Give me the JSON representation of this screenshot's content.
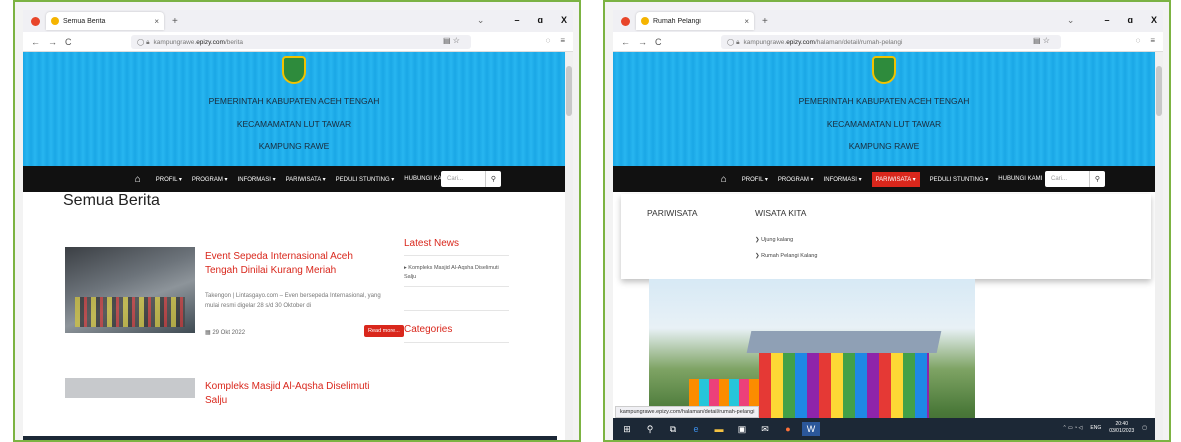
{
  "left": {
    "tab_title": "Semua Berita",
    "tab_close": "×",
    "new_tab": "+",
    "url_prefix": "kampungrawe.",
    "url_host": "epizy.com",
    "url_path": "/berita",
    "banner": {
      "line1": "PEMERINTAH KABUPATEN ACEH TENGAH",
      "line2": "KECAMAMATAN LUT TAWAR",
      "line3": "KAMPUNG RAWE"
    },
    "menu": [
      "PROFIL ▾",
      "PROGRAM ▾",
      "INFORMASI ▾",
      "PARIWISATA ▾",
      "PEDULI STUNTING ▾",
      "HUBUNGI KAMI"
    ],
    "search_placeholder": "Cari...",
    "page_title": "Semua Berita",
    "posts": [
      {
        "title": "Event Sepeda Internasional Aceh Tengah Dinilai Kurang Meriah",
        "excerpt": "Takengon | Lintasgayo.com – Even bersepeda Internasional, yang mulai resmi digelar 28 s/d 30 Oktober di",
        "date": "29 Okt 2022",
        "read_more": "Read more..."
      },
      {
        "title": "Kompleks Masjid Al-Aqsha Diselimuti Salju"
      }
    ],
    "sidebar": {
      "latest_heading": "Latest News",
      "latest_item": "▸ Kompleks Masjid Al-Aqsha Diselimuti Salju",
      "categories_heading": "Categories"
    }
  },
  "right": {
    "tab_title": "Rumah Pelangi",
    "tab_close": "×",
    "new_tab": "+",
    "url_prefix": "kampungrawe.",
    "url_host": "epizy.com",
    "url_path": "/halaman/detail/rumah-pelangi",
    "banner": {
      "line1": "PEMERINTAH KABUPATEN ACEH TENGAH",
      "line2": "KECAMAMATAN LUT TAWAR",
      "line3": "KAMPUNG RAWE"
    },
    "menu": [
      "PROFIL ▾",
      "PROGRAM ▾",
      "INFORMASI ▾",
      "PARIWISATA ▾",
      "PEDULI STUNTING ▾",
      "HUBUNGI KAMI"
    ],
    "search_placeholder": "Cari...",
    "mega": {
      "col1": "PARIWISATA",
      "col2": "WISATA KITA",
      "items": [
        "❯ Ujung kalang",
        "❯ Rumah Pelangi Kalang"
      ]
    },
    "status_link": "kampungrawe.epizy.com/halaman/detail/rumah-pelangi",
    "tray": {
      "lang": "ENG",
      "time": "20:40",
      "date": "03/01/2023"
    }
  },
  "window_controls": {
    "dropdown": "⌄",
    "minimize": "–",
    "maximize": "ɑ",
    "close": "X"
  },
  "nav_icons": {
    "back": "←",
    "forward": "→",
    "reload": "C"
  },
  "colors": {
    "accent": "#d9271c",
    "banner": "#1aa7e6",
    "frame": "#7cb342"
  }
}
